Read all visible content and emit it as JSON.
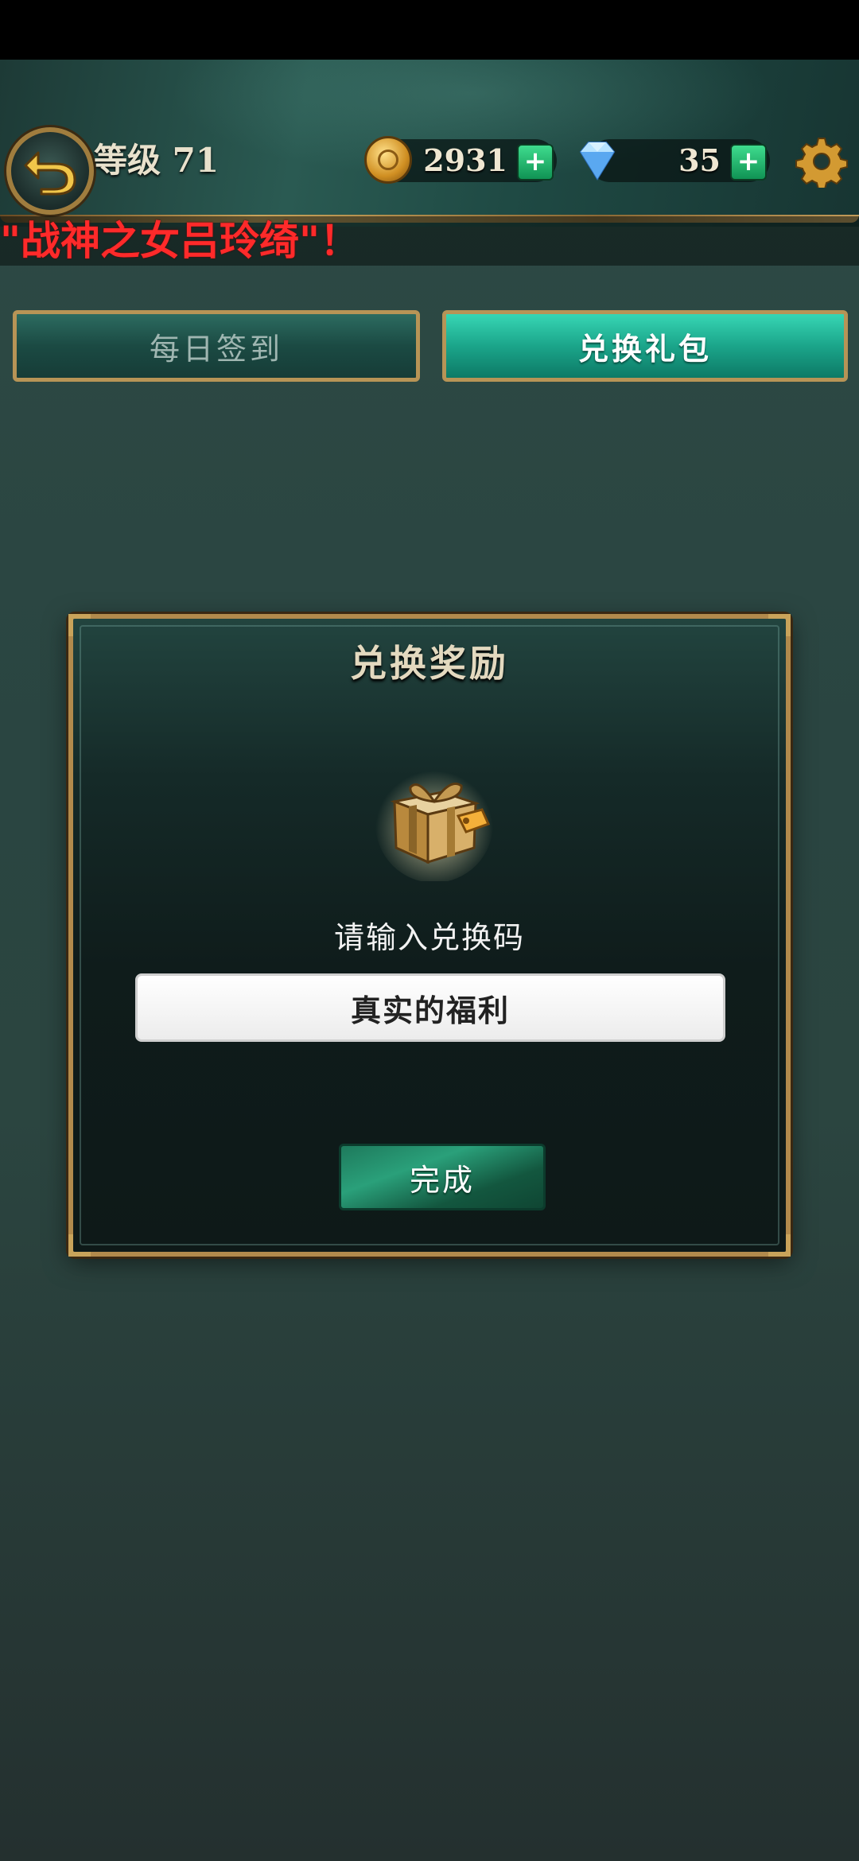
{
  "header": {
    "level_label": "等级 71",
    "coins": "2931",
    "gems": "35",
    "coins_plus": "+",
    "gems_plus": "+",
    "scroll_notice": "\"战神之女吕玲绮\"！"
  },
  "tabs": [
    {
      "label": "每日签到",
      "active": false
    },
    {
      "label": "兑换礼包",
      "active": true
    }
  ],
  "dialog": {
    "title": "兑换奖励",
    "prompt": "请输入兑换码",
    "code_value": "真实的福利",
    "confirm_label": "完成"
  },
  "icons": {
    "back": "back-arrow-icon",
    "coin": "gold-coin-icon",
    "gem": "diamond-icon",
    "settings": "gear-icon",
    "gift": "gift-box-icon"
  },
  "colors": {
    "notice_red": "#ff2a2a",
    "tab_active": "#1ba58a",
    "gold_border": "#b28a4c"
  }
}
